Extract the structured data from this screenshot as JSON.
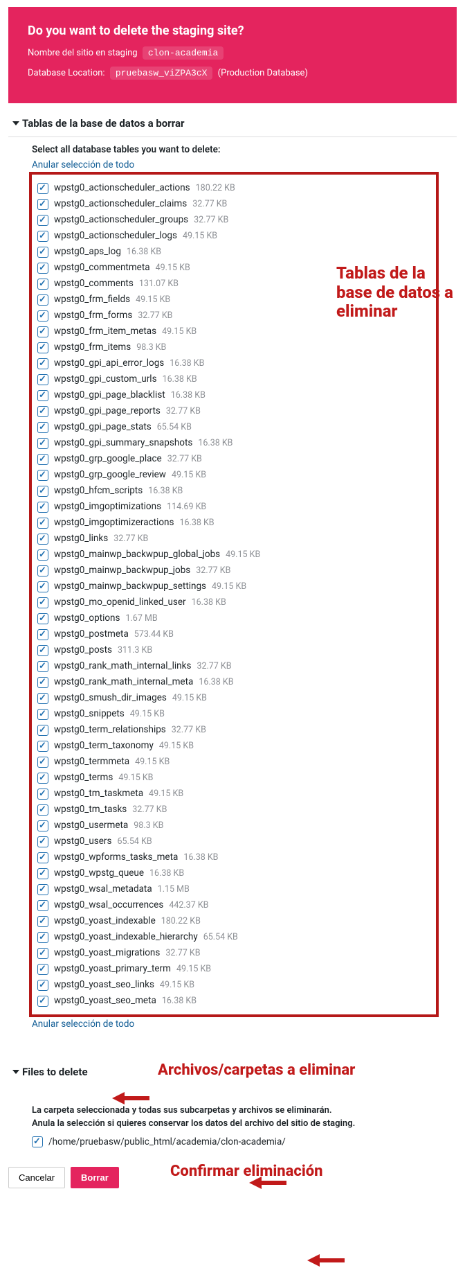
{
  "header": {
    "title": "Do you want to delete the staging site?",
    "siteLabel": "Nombre del sitio en staging",
    "siteName": "clon-academia",
    "dbLocLabel": "Database Location:",
    "dbName": "pruebasw_viZPA3cX",
    "dbSuffix": "(Production Database)"
  },
  "tablesSection": {
    "title": "Tablas de la base de datos a borrar",
    "selectLabel": "Select all database tables you want to delete:",
    "unselectLink": "Anular selección de todo",
    "tables": [
      {
        "name": "wpstg0_actionscheduler_actions",
        "size": "180.22 KB"
      },
      {
        "name": "wpstg0_actionscheduler_claims",
        "size": "32.77 KB"
      },
      {
        "name": "wpstg0_actionscheduler_groups",
        "size": "32.77 KB"
      },
      {
        "name": "wpstg0_actionscheduler_logs",
        "size": "49.15 KB"
      },
      {
        "name": "wpstg0_aps_log",
        "size": "16.38 KB"
      },
      {
        "name": "wpstg0_commentmeta",
        "size": "49.15 KB"
      },
      {
        "name": "wpstg0_comments",
        "size": "131.07 KB"
      },
      {
        "name": "wpstg0_frm_fields",
        "size": "49.15 KB"
      },
      {
        "name": "wpstg0_frm_forms",
        "size": "32.77 KB"
      },
      {
        "name": "wpstg0_frm_item_metas",
        "size": "49.15 KB"
      },
      {
        "name": "wpstg0_frm_items",
        "size": "98.3 KB"
      },
      {
        "name": "wpstg0_gpi_api_error_logs",
        "size": "16.38 KB"
      },
      {
        "name": "wpstg0_gpi_custom_urls",
        "size": "16.38 KB"
      },
      {
        "name": "wpstg0_gpi_page_blacklist",
        "size": "16.38 KB"
      },
      {
        "name": "wpstg0_gpi_page_reports",
        "size": "32.77 KB"
      },
      {
        "name": "wpstg0_gpi_page_stats",
        "size": "65.54 KB"
      },
      {
        "name": "wpstg0_gpi_summary_snapshots",
        "size": "16.38 KB"
      },
      {
        "name": "wpstg0_grp_google_place",
        "size": "32.77 KB"
      },
      {
        "name": "wpstg0_grp_google_review",
        "size": "49.15 KB"
      },
      {
        "name": "wpstg0_hfcm_scripts",
        "size": "16.38 KB"
      },
      {
        "name": "wpstg0_imgoptimizations",
        "size": "114.69 KB"
      },
      {
        "name": "wpstg0_imgoptimizeractions",
        "size": "16.38 KB"
      },
      {
        "name": "wpstg0_links",
        "size": "32.77 KB"
      },
      {
        "name": "wpstg0_mainwp_backwpup_global_jobs",
        "size": "49.15 KB"
      },
      {
        "name": "wpstg0_mainwp_backwpup_jobs",
        "size": "32.77 KB"
      },
      {
        "name": "wpstg0_mainwp_backwpup_settings",
        "size": "49.15 KB"
      },
      {
        "name": "wpstg0_mo_openid_linked_user",
        "size": "16.38 KB"
      },
      {
        "name": "wpstg0_options",
        "size": "1.67 MB"
      },
      {
        "name": "wpstg0_postmeta",
        "size": "573.44 KB"
      },
      {
        "name": "wpstg0_posts",
        "size": "311.3 KB"
      },
      {
        "name": "wpstg0_rank_math_internal_links",
        "size": "32.77 KB"
      },
      {
        "name": "wpstg0_rank_math_internal_meta",
        "size": "16.38 KB"
      },
      {
        "name": "wpstg0_smush_dir_images",
        "size": "49.15 KB"
      },
      {
        "name": "wpstg0_snippets",
        "size": "49.15 KB"
      },
      {
        "name": "wpstg0_term_relationships",
        "size": "32.77 KB"
      },
      {
        "name": "wpstg0_term_taxonomy",
        "size": "49.15 KB"
      },
      {
        "name": "wpstg0_termmeta",
        "size": "49.15 KB"
      },
      {
        "name": "wpstg0_terms",
        "size": "49.15 KB"
      },
      {
        "name": "wpstg0_tm_taskmeta",
        "size": "49.15 KB"
      },
      {
        "name": "wpstg0_tm_tasks",
        "size": "32.77 KB"
      },
      {
        "name": "wpstg0_usermeta",
        "size": "98.3 KB"
      },
      {
        "name": "wpstg0_users",
        "size": "65.54 KB"
      },
      {
        "name": "wpstg0_wpforms_tasks_meta",
        "size": "16.38 KB"
      },
      {
        "name": "wpstg0_wpstg_queue",
        "size": "16.38 KB"
      },
      {
        "name": "wpstg0_wsal_metadata",
        "size": "1.15 MB"
      },
      {
        "name": "wpstg0_wsal_occurrences",
        "size": "442.37 KB"
      },
      {
        "name": "wpstg0_yoast_indexable",
        "size": "180.22 KB"
      },
      {
        "name": "wpstg0_yoast_indexable_hierarchy",
        "size": "65.54 KB"
      },
      {
        "name": "wpstg0_yoast_migrations",
        "size": "32.77 KB"
      },
      {
        "name": "wpstg0_yoast_primary_term",
        "size": "49.15 KB"
      },
      {
        "name": "wpstg0_yoast_seo_links",
        "size": "49.15 KB"
      },
      {
        "name": "wpstg0_yoast_seo_meta",
        "size": "16.38 KB"
      }
    ]
  },
  "filesSection": {
    "title": "Files to delete",
    "note1": "La carpeta seleccionada y todas sus subcarpetas y archivos se eliminarán.",
    "note2": "Anula la selección si quieres conservar los datos del archivo del sitio de staging.",
    "path": "/home/pruebasw/public_html/academia/clon-academia/"
  },
  "buttons": {
    "cancel": "Cancelar",
    "delete": "Borrar"
  },
  "annotations": {
    "tables": "Tablas de la base de datos a eliminar",
    "files": "Archivos/carpetas a eliminar",
    "confirm": "Confirmar eliminación"
  }
}
